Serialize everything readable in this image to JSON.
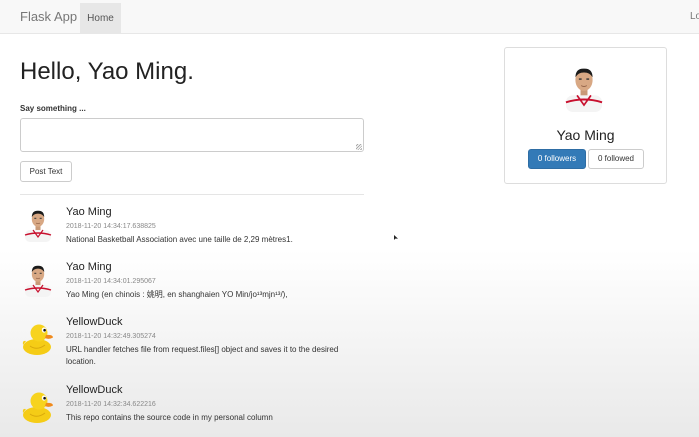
{
  "navbar": {
    "brand": "Flask App",
    "home": "Home",
    "login": "Login"
  },
  "main": {
    "greeting": "Hello, Yao Ming.",
    "form": {
      "label": "Say something ...",
      "text_value": "",
      "submit": "Post Text"
    }
  },
  "posts": [
    {
      "author": "Yao Ming",
      "timestamp": "2018-11-20 14:34:17.638825",
      "text": "National Basketball Association avec une taille de 2,29 mètres1.",
      "avatar": "yao-ming-avatar"
    },
    {
      "author": "Yao Ming",
      "timestamp": "2018-11-20 14:34:01.295067",
      "text": "Yao Ming (en chinois : 姚明, en shanghaien YO Min/jo¹³mjn¹³/),",
      "avatar": "yao-ming-avatar"
    },
    {
      "author": "YellowDuck",
      "timestamp": "2018-11-20 14:32:49.305274",
      "text": "URL handler fetches file from request.files[] object and saves it to the desired location.",
      "avatar": "yellow-duck-avatar"
    },
    {
      "author": "YellowDuck",
      "timestamp": "2018-11-20 14:32:34.622216",
      "text": "This repo contains the source code in my personal column",
      "avatar": "yellow-duck-avatar"
    }
  ],
  "profile": {
    "name": "Yao Ming",
    "followers_label": "0 followers",
    "followed_label": "0 followed"
  },
  "colors": {
    "primary": "#337ab7",
    "navbar_bg": "#f8f8f8",
    "duck": "#f5cc16",
    "jersey": "#c8102e"
  }
}
